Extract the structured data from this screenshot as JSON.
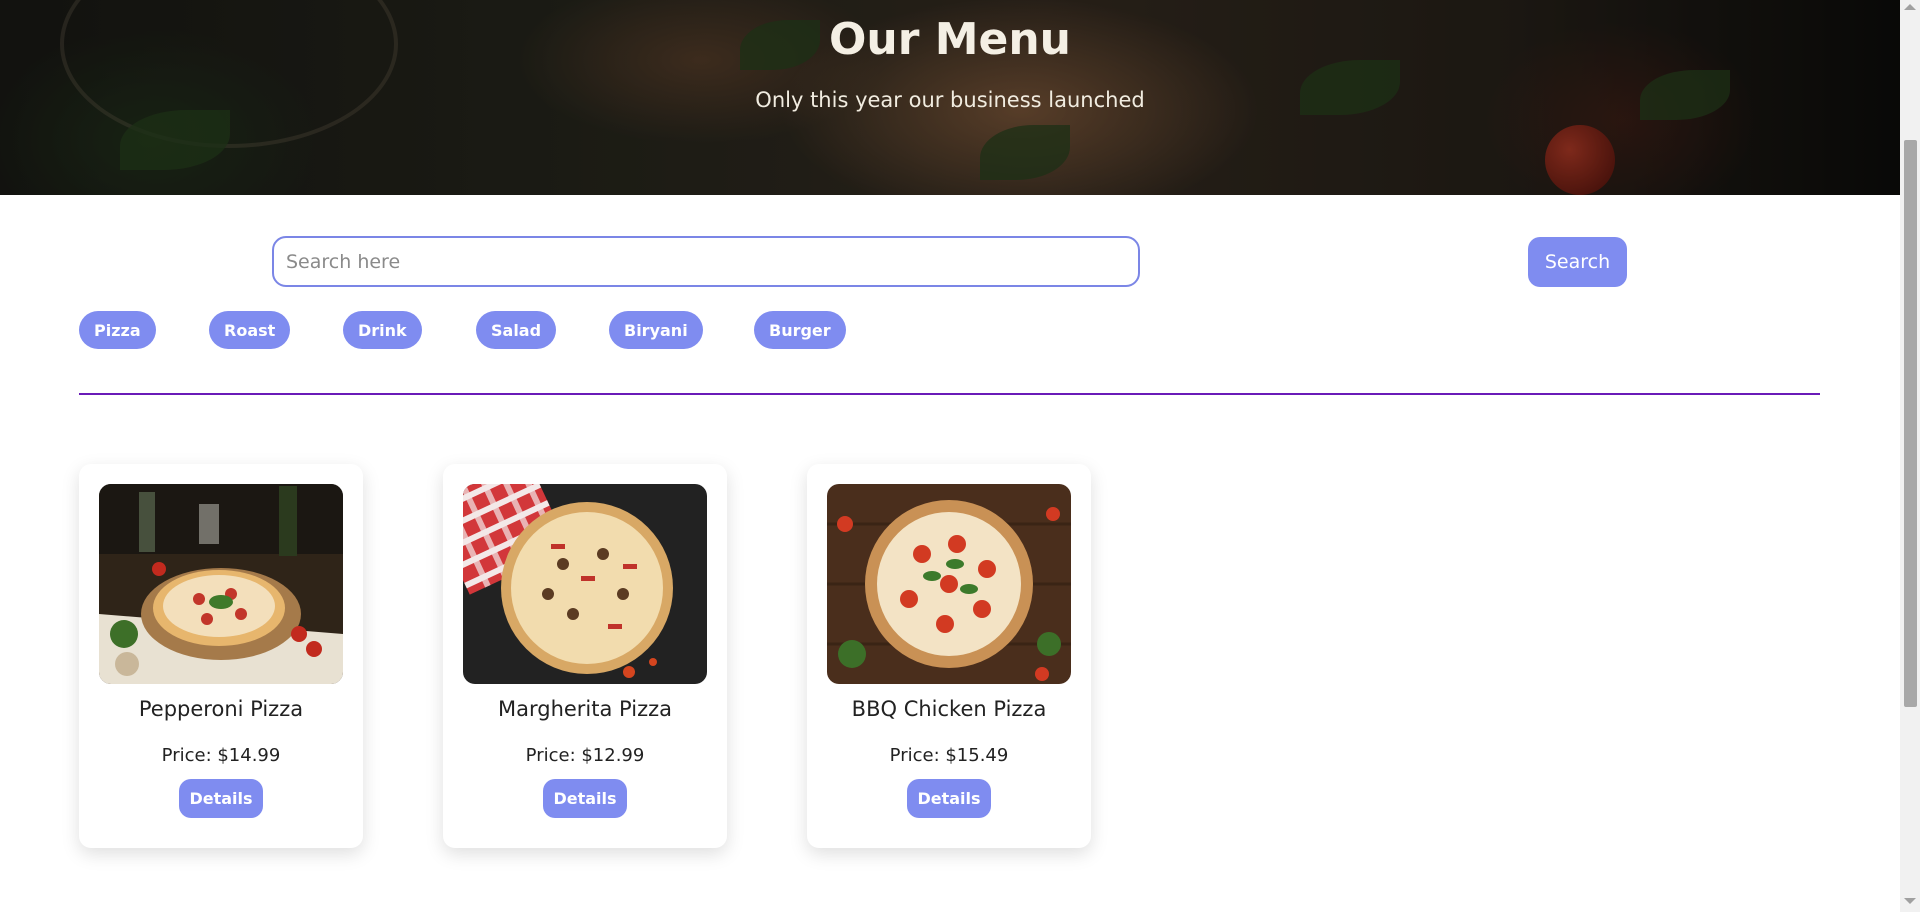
{
  "hero": {
    "title": "Our Menu",
    "subtitle": "Only this year our business launched"
  },
  "search": {
    "placeholder": "Search here",
    "value": "",
    "button_label": "Search"
  },
  "categories": [
    "Pizza",
    "Roast",
    "Drink",
    "Salad",
    "Biryani",
    "Burger"
  ],
  "products": [
    {
      "name": "Pepperoni Pizza",
      "price": "Price: $14.99",
      "details_label": "Details",
      "image": "pizza-photo"
    },
    {
      "name": "Margherita Pizza",
      "price": "Price: $12.99",
      "details_label": "Details",
      "image": "pizza-photo"
    },
    {
      "name": "BBQ Chicken Pizza",
      "price": "Price: $15.49",
      "details_label": "Details",
      "image": "pizza-photo"
    }
  ],
  "colors": {
    "accent": "#7f8cf0",
    "divider": "#6a1bb8",
    "input_border": "#7b86e6"
  }
}
